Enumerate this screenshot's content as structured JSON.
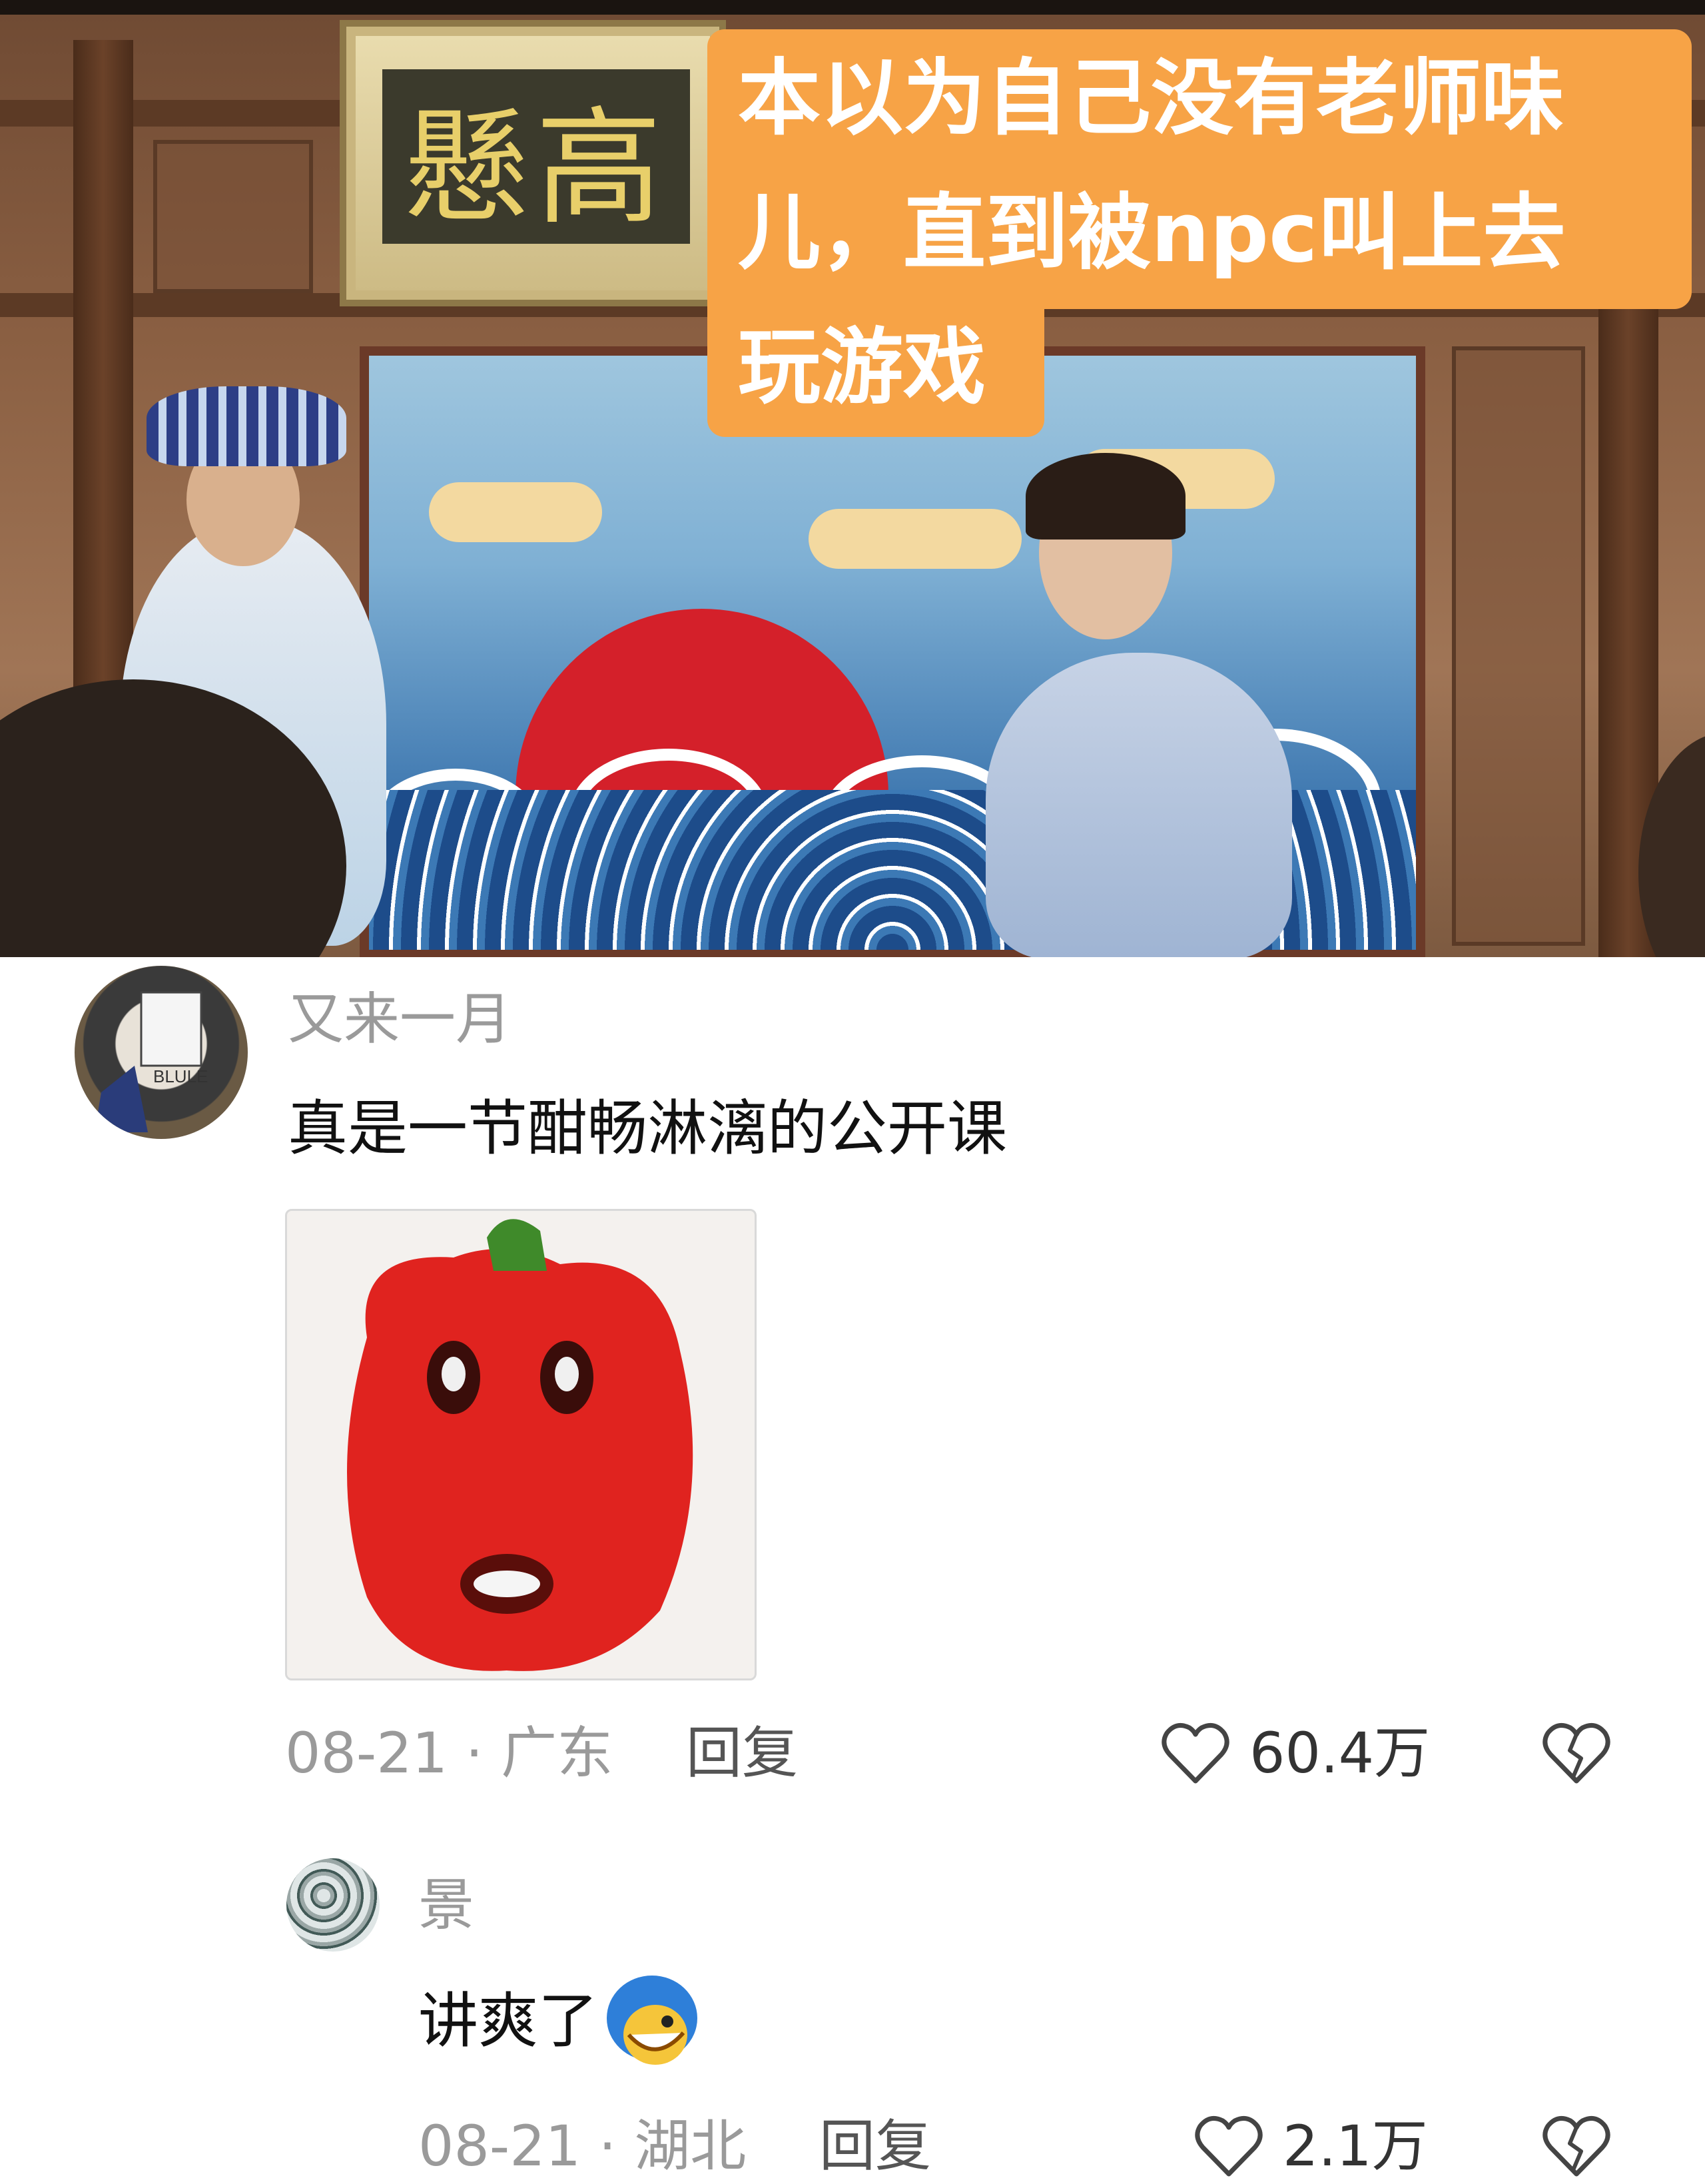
{
  "video": {
    "plaque_text": "懸高",
    "caption_lines": [
      "本以为自己没有老师味",
      "儿，直到被npc叫上去",
      "玩游戏"
    ]
  },
  "comment": {
    "username": "又来一月",
    "text": "真是一节酣畅淋漓的公开课",
    "date_location": "08-21 · 广东",
    "reply_label": "回复",
    "like_count": "60.4万",
    "avatar_icon": "avatar-blule-icon",
    "sticker_icon": "red-pepper-face-sticker",
    "like_icon": "heart-outline-icon",
    "dislike_icon": "broken-heart-icon"
  },
  "reply": {
    "username": "景",
    "text": "讲爽了",
    "date_location": "08-21 · 湖北",
    "reply_label": "回复",
    "like_count": "2.1万",
    "emoji_icon": "blue-hair-grin-emoji",
    "like_icon": "heart-outline-icon",
    "dislike_icon": "broken-heart-icon"
  },
  "colors": {
    "caption_bg": "#f7a346",
    "meta_gray": "#9a9a9a"
  }
}
